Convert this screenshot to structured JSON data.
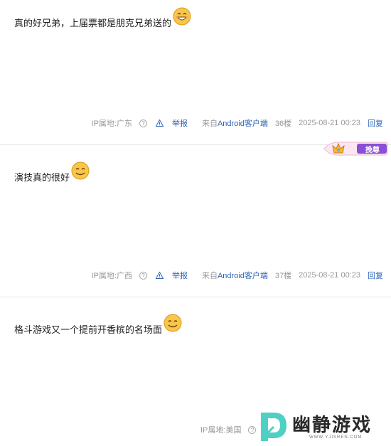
{
  "posts": [
    {
      "text": "真的好兄弟，上届票都是朋克兄弟送的",
      "ip": "IP属地:广东",
      "report": "举报",
      "from_prefix": "来自",
      "from_client": "Android客户端",
      "floor": "36楼",
      "time": "2025-08-21 00:23",
      "reply": "回复"
    },
    {
      "text": "演技真的很好",
      "ip": "IP属地:广西",
      "report": "举报",
      "from_prefix": "来自",
      "from_client": "Android客户端",
      "floor": "37楼",
      "time": "2025-08-21 00:23",
      "reply": "回复"
    },
    {
      "text": "格斗游戏又一个提前开香槟的名场面",
      "ip": "IP属地:美国"
    }
  ],
  "badge": {
    "label": "挽尊"
  },
  "watermark": {
    "title": "幽静游戏",
    "url": "WWW.YJISREN.COM"
  },
  "colors": {
    "link": "#2d64b3",
    "muted": "#999999",
    "badge": "#8a4fd6"
  }
}
